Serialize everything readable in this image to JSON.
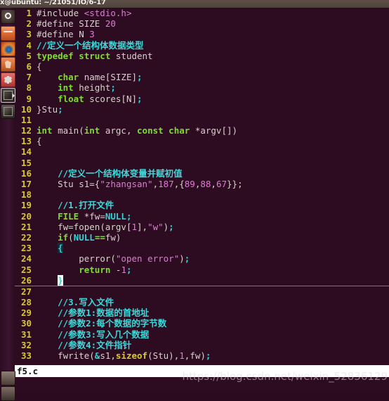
{
  "window": {
    "titlebar_text": "x@ubuntu: ~/21051/IO/6-17"
  },
  "launcher": {
    "items": [
      {
        "name": "ubuntu-dash-icon",
        "label": "Ubuntu Dash"
      },
      {
        "name": "files-icon",
        "label": "Files"
      },
      {
        "name": "firefox-icon",
        "label": "Firefox"
      },
      {
        "name": "software-icon",
        "label": "Ubuntu Software"
      },
      {
        "name": "settings-icon",
        "label": "System Settings"
      },
      {
        "name": "terminal-icon",
        "label": "Terminal"
      },
      {
        "name": "terminal-2-icon",
        "label": "Terminal"
      },
      {
        "name": "trash-icon",
        "label": "Trash"
      },
      {
        "name": "show-desktop-icon",
        "label": "Show Desktop"
      }
    ]
  },
  "editor": {
    "filename": "f5.c",
    "cursor_line": 26,
    "lines": [
      {
        "n": 1,
        "text": "#include <stdio.h>"
      },
      {
        "n": 2,
        "text": "#define SIZE 20"
      },
      {
        "n": 3,
        "text": "#define N 3"
      },
      {
        "n": 4,
        "text": "//定义一个结构体数据类型"
      },
      {
        "n": 5,
        "text": "typedef struct student"
      },
      {
        "n": 6,
        "text": "{"
      },
      {
        "n": 7,
        "text": "    char name[SIZE];"
      },
      {
        "n": 8,
        "text": "    int height;"
      },
      {
        "n": 9,
        "text": "    float scores[N];"
      },
      {
        "n": 10,
        "text": "}Stu;"
      },
      {
        "n": 11,
        "text": ""
      },
      {
        "n": 12,
        "text": "int main(int argc, const char *argv[])"
      },
      {
        "n": 13,
        "text": "{"
      },
      {
        "n": 14,
        "text": ""
      },
      {
        "n": 15,
        "text": ""
      },
      {
        "n": 16,
        "text": "    //定义一个结构体变量并赋初值"
      },
      {
        "n": 17,
        "text": "    Stu s1={\"zhangsan\",187,{89,88,67}};"
      },
      {
        "n": 18,
        "text": ""
      },
      {
        "n": 19,
        "text": "    //1.打开文件"
      },
      {
        "n": 20,
        "text": "    FILE *fw=NULL;"
      },
      {
        "n": 21,
        "text": "    fw=fopen(argv[1],\"w\");"
      },
      {
        "n": 22,
        "text": "    if(NULL==fw)"
      },
      {
        "n": 23,
        "text": "    {"
      },
      {
        "n": 24,
        "text": "        perror(\"open error\");"
      },
      {
        "n": 25,
        "text": "        return -1;"
      },
      {
        "n": 26,
        "text": "    }"
      },
      {
        "n": 27,
        "text": ""
      },
      {
        "n": 28,
        "text": "    //3.写入文件"
      },
      {
        "n": 29,
        "text": "    //参数1:数据的首地址"
      },
      {
        "n": 30,
        "text": "    //参数2:每个数据的字节数"
      },
      {
        "n": 31,
        "text": "    //参数3:写入几个数据"
      },
      {
        "n": 32,
        "text": "    //参数4:文件指针"
      },
      {
        "n": 33,
        "text": "    fwrite(&s1,sizeof(Stu),1,fw);"
      }
    ]
  },
  "statusline": {
    "text": "f5.c"
  },
  "watermark": {
    "text": "https://blog.csdn.net/weixin_52836129"
  },
  "colors": {
    "background": "#2d0b21",
    "line_number": "#d8c932",
    "comment": "#3fd8d8",
    "keyword": "#7ddc2e",
    "string": "#d67fd0",
    "number": "#e07ad8",
    "cyan_token": "#2fd4d4",
    "foreground": "#d8d2cc",
    "statusline_bg": "#ffffff",
    "titlebar_bg": "#4e433c"
  }
}
